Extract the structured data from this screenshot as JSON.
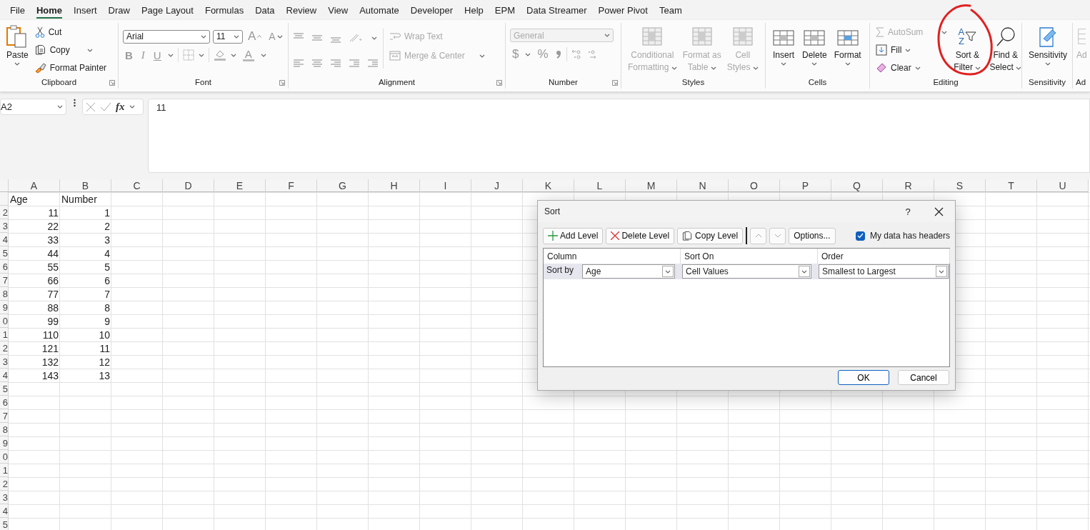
{
  "menu_tabs": [
    {
      "label": "File",
      "selected": false
    },
    {
      "label": "Home",
      "selected": true
    },
    {
      "label": "Insert",
      "selected": false
    },
    {
      "label": "Draw",
      "selected": false
    },
    {
      "label": "Page Layout",
      "selected": false
    },
    {
      "label": "Formulas",
      "selected": false
    },
    {
      "label": "Data",
      "selected": false
    },
    {
      "label": "Review",
      "selected": false
    },
    {
      "label": "View",
      "selected": false
    },
    {
      "label": "Automate",
      "selected": false
    },
    {
      "label": "Developer",
      "selected": false
    },
    {
      "label": "Help",
      "selected": false
    },
    {
      "label": "EPM",
      "selected": false
    },
    {
      "label": "Data Streamer",
      "selected": false
    },
    {
      "label": "Power Pivot",
      "selected": false
    },
    {
      "label": "Team",
      "selected": false
    }
  ],
  "ribbon": {
    "clipboard": {
      "label": "Clipboard",
      "paste": "Paste",
      "cut": "Cut",
      "copy": "Copy",
      "format_painter": "Format Painter"
    },
    "font": {
      "label": "Font",
      "family": "Arial",
      "size": "11",
      "grow": "A",
      "shrink": "A",
      "styles": [
        "B",
        "I",
        "U"
      ],
      "font_color": "A"
    },
    "alignment": {
      "label": "Alignment",
      "wrap_text": {
        "label": "Wrap Text",
        "disabled": true
      },
      "merge_center": {
        "label": "Merge & Center",
        "disabled": true
      }
    },
    "number": {
      "label": "Number",
      "format": {
        "value": "General",
        "disabled": true
      },
      "currency": "$",
      "percent": "%"
    },
    "styles": {
      "label": "Styles",
      "buttons": [
        {
          "lines": [
            "Conditional",
            "Formatting"
          ],
          "disabled": true
        },
        {
          "lines": [
            "Format as",
            "Table"
          ],
          "disabled": true
        },
        {
          "lines": [
            "Cell",
            "Styles"
          ],
          "disabled": true
        }
      ]
    },
    "cells": {
      "label": "Cells",
      "buttons": [
        "Insert",
        "Delete",
        "Format"
      ]
    },
    "editing": {
      "label": "Editing",
      "autosum": {
        "label": "AutoSum",
        "disabled": true
      },
      "fill": "Fill",
      "clear": "Clear",
      "sort_letters": [
        "A",
        "Z"
      ],
      "sort_filter": [
        "Sort &",
        "Filter"
      ],
      "find_select": [
        "Find &",
        "Select"
      ]
    },
    "sensitivity": {
      "label": "Sensitivity",
      "button": "Sensitivity"
    },
    "partial": {
      "label": "Ad",
      "button": "Ad"
    }
  },
  "formula_bar": {
    "name_box": "A2",
    "fx": "fx",
    "formula": "11"
  },
  "sheet": {
    "columns": [
      "A",
      "B",
      "C",
      "D",
      "E",
      "F",
      "G",
      "H",
      "I",
      "J",
      "K",
      "L",
      "M",
      "N",
      "O",
      "P",
      "Q",
      "R",
      "S",
      "T",
      "U"
    ],
    "header_row": {
      "cells": [
        "Age",
        "Number"
      ]
    },
    "rows": [
      {
        "number": "2",
        "cells": [
          "11",
          "1"
        ]
      },
      {
        "number": "3",
        "cells": [
          "22",
          "2"
        ]
      },
      {
        "number": "4",
        "cells": [
          "33",
          "3"
        ]
      },
      {
        "number": "5",
        "cells": [
          "44",
          "4"
        ]
      },
      {
        "number": "6",
        "cells": [
          "55",
          "5"
        ]
      },
      {
        "number": "7",
        "cells": [
          "66",
          "6"
        ]
      },
      {
        "number": "8",
        "cells": [
          "77",
          "7"
        ]
      },
      {
        "number": "9",
        "cells": [
          "88",
          "8"
        ]
      },
      {
        "number": "0",
        "cells": [
          "99",
          "9"
        ]
      },
      {
        "number": "1",
        "cells": [
          "110",
          "10"
        ]
      },
      {
        "number": "2",
        "cells": [
          "121",
          "11"
        ]
      },
      {
        "number": "3",
        "cells": [
          "132",
          "12"
        ]
      },
      {
        "number": "4",
        "cells": [
          "143",
          "13"
        ]
      },
      {
        "number": "5",
        "cells": []
      },
      {
        "number": "6",
        "cells": []
      },
      {
        "number": "7",
        "cells": []
      },
      {
        "number": "8",
        "cells": []
      },
      {
        "number": "9",
        "cells": []
      },
      {
        "number": "0",
        "cells": []
      },
      {
        "number": "1",
        "cells": []
      },
      {
        "number": "2",
        "cells": []
      },
      {
        "number": "3",
        "cells": []
      },
      {
        "number": "4",
        "cells": []
      },
      {
        "number": "5",
        "cells": []
      }
    ]
  },
  "dialog": {
    "title": "Sort",
    "help": "?",
    "buttons": [
      "Add Level",
      "Delete Level",
      "Copy Level"
    ],
    "options": "Options...",
    "headers_checkbox": {
      "label": "My data has headers",
      "checked": true
    },
    "columns": [
      "Column",
      "Sort On",
      "Order"
    ],
    "level": {
      "label": "Sort by",
      "column": "Age",
      "sort_on": "Cell Values",
      "order": "Smallest to Largest"
    },
    "ok": "OK",
    "cancel": "Cancel"
  }
}
